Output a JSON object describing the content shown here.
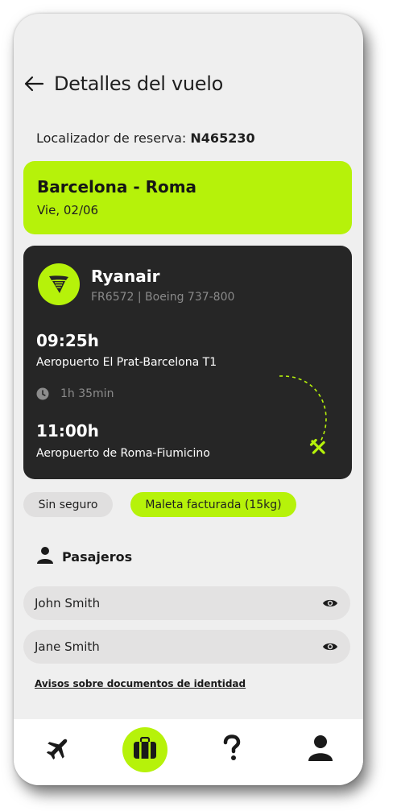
{
  "header": {
    "title": "Detalles del vuelo"
  },
  "booking": {
    "label": "Localizador de reserva:",
    "code": "N465230"
  },
  "route": {
    "title": "Barcelona - Roma",
    "date": "Vie, 02/06"
  },
  "flight": {
    "airline": "Ryanair",
    "info": "FR6572 | Boeing 737-800",
    "departure": {
      "time": "09:25h",
      "airport": "Aeropuerto El Prat-Barcelona T1"
    },
    "duration": "1h 35min",
    "arrival": {
      "time": "11:00h",
      "airport": "Aeropuerto de Roma-Fiumicino"
    }
  },
  "extras": [
    "Sin seguro",
    "Maleta facturada (15kg)"
  ],
  "passengers": {
    "title": "Pasajeros",
    "list": [
      {
        "name": "John Smith"
      },
      {
        "name": "Jane Smith"
      }
    ]
  },
  "id_notice_link": "Avisos sobre documentos de identidad",
  "tabbar": {
    "items": [
      {
        "icon": "plane-icon",
        "active": false
      },
      {
        "icon": "suitcase-icon",
        "active": true
      },
      {
        "icon": "question-icon",
        "active": false
      },
      {
        "icon": "user-icon",
        "active": false
      }
    ]
  },
  "colors": {
    "accent": "#b6f20a",
    "card_dark": "#262626",
    "background": "#efefef"
  }
}
